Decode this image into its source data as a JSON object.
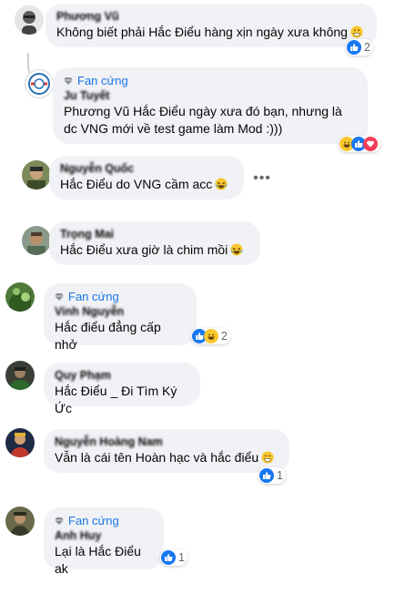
{
  "badge_label": "Fan cứng",
  "comments": [
    {
      "name": "Phương Vũ",
      "text": "Không biết phải Hắc Điểu hàng xịn ngày xưa không",
      "reactions": "2"
    },
    {
      "name": "Ju Tuyết",
      "text": "Phương Vũ Hắc Điểu ngày xưa đó bạn, nhưng là dc VNG mới về test game làm Mod :)))",
      "reactions": ""
    },
    {
      "name": "Nguyễn Quốc",
      "text": "Hắc Điểu do VNG cầm acc",
      "reactions": ""
    },
    {
      "name": "Trọng Mai",
      "text": "Hắc Điểu xưa giờ là chim mồi",
      "reactions": ""
    },
    {
      "name": "Vinh Nguyễn",
      "text": "Hắc điểu đẳng cấp nhở",
      "reactions": "2"
    },
    {
      "name": "Quy Phạm",
      "text": "Hắc Điểu _ Đi Tìm Ký Ức",
      "reactions": ""
    },
    {
      "name": "Nguyễn Hoàng Nam",
      "text": "Vẫn là cái tên Hoàn hạc và hắc điểu",
      "reactions": "1"
    },
    {
      "name": "Anh Huy",
      "text": "Lại là Hắc Điểu ak",
      "reactions": "1"
    }
  ],
  "colors": {
    "bubble": "#f0f2f5",
    "badge": "#1b74e4",
    "like": "#1877f2"
  },
  "more_label": "•••"
}
